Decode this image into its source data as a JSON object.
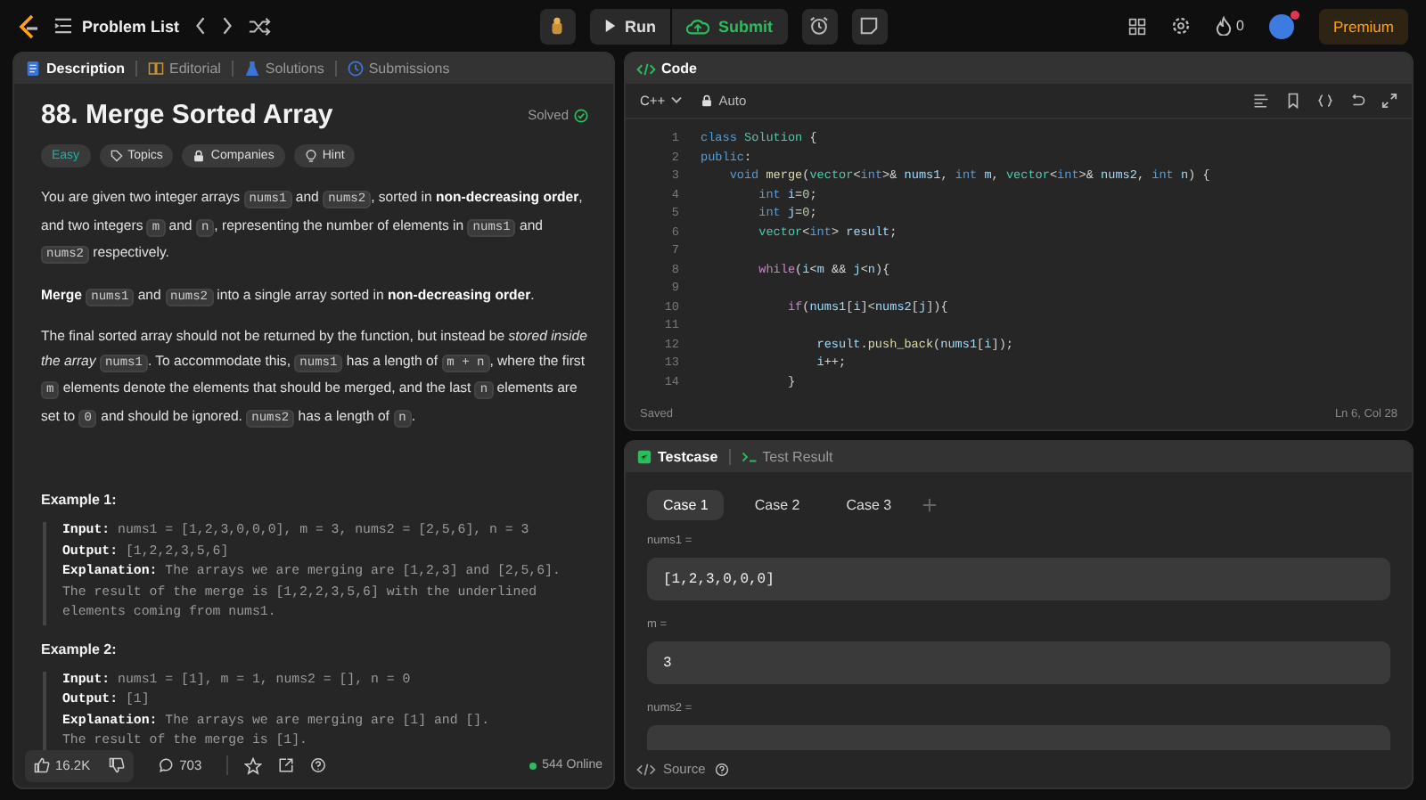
{
  "nav": {
    "title": "Problem List"
  },
  "actions": [
    {
      "label": "Run",
      "kind": "run"
    },
    {
      "label": "Submit",
      "kind": "submit"
    }
  ],
  "streak": {
    "count": "0"
  },
  "premium": {
    "label": "Premium"
  },
  "left_tabs": [
    {
      "label": "Description",
      "selected": true,
      "kind": "description"
    },
    {
      "label": "Editorial",
      "selected": false,
      "kind": "editorial"
    },
    {
      "label": "Solutions",
      "selected": false,
      "kind": "solutions"
    },
    {
      "label": "Submissions",
      "selected": false,
      "kind": "submissions"
    }
  ],
  "problem": {
    "title": "88. Merge Sorted Array",
    "status": "Solved",
    "tags": [
      {
        "label": "Easy",
        "kind": "difficulty"
      },
      {
        "label": "Topics",
        "kind": "topics"
      },
      {
        "label": "Companies",
        "kind": "companies"
      },
      {
        "label": "Hint",
        "kind": "hint"
      }
    ],
    "paragraphs": [
      [
        {
          "t": "You are given two integer arrays ",
          "kind": "text"
        },
        {
          "t": "nums1",
          "kind": "code"
        },
        {
          "t": " and ",
          "kind": "text"
        },
        {
          "t": "nums2",
          "kind": "code"
        },
        {
          "t": ", sorted in **non-decreasing order**, and two integers ",
          "kind": "text"
        },
        {
          "t": "m",
          "kind": "code"
        },
        {
          "t": " and ",
          "kind": "text"
        },
        {
          "t": "n",
          "kind": "code"
        },
        {
          "t": ", representing the number of elements in ",
          "kind": "text"
        },
        {
          "t": "nums1",
          "kind": "code"
        },
        {
          "t": " and ",
          "kind": "text"
        },
        {
          "t": "nums2",
          "kind": "code"
        },
        {
          "t": " respectively.",
          "kind": "text"
        }
      ],
      [
        {
          "t": "**Merge** ",
          "kind": "text"
        },
        {
          "t": "nums1",
          "kind": "code"
        },
        {
          "t": " and ",
          "kind": "text"
        },
        {
          "t": "nums2",
          "kind": "code"
        },
        {
          "t": " into a single array sorted in **non-decreasing order**.",
          "kind": "text"
        }
      ],
      [
        {
          "t": "The final sorted array should not be returned by the function, but instead be *stored inside the array* ",
          "kind": "text"
        },
        {
          "t": "nums1",
          "kind": "code"
        },
        {
          "t": ". To accommodate this, ",
          "kind": "text"
        },
        {
          "t": "nums1",
          "kind": "code"
        },
        {
          "t": " has a length of ",
          "kind": "text"
        },
        {
          "t": "m + n",
          "kind": "code"
        },
        {
          "t": ", where the first ",
          "kind": "text"
        },
        {
          "t": "m",
          "kind": "code"
        },
        {
          "t": " elements denote the elements that should be merged, and the last ",
          "kind": "text"
        },
        {
          "t": "n",
          "kind": "code"
        },
        {
          "t": " elements are set to ",
          "kind": "text"
        },
        {
          "t": "0",
          "kind": "code"
        },
        {
          "t": " and should be ignored. ",
          "kind": "text"
        },
        {
          "t": "nums2",
          "kind": "code"
        },
        {
          "t": " has a length of ",
          "kind": "text"
        },
        {
          "t": "n",
          "kind": "code"
        },
        {
          "t": ".",
          "kind": "text"
        }
      ]
    ],
    "examples": [
      {
        "title": "Example 1:",
        "lines": [
          "**Input:** nums1 = [1,2,3,0,0,0], m = 3, nums2 = [2,5,6], n = 3",
          "**Output:** [1,2,2,3,5,6]",
          "**Explanation:** The arrays we are merging are [1,2,3] and [2,5,6].",
          "The result of the merge is [1,2,2,3,5,6] with the underlined",
          "elements coming from nums1."
        ]
      },
      {
        "title": "Example 2:",
        "lines": [
          "**Input:** nums1 = [1], m = 1, nums2 = [], n = 0",
          "**Output:** [1]",
          "**Explanation:** The arrays we are merging are [1] and [].",
          "The result of the merge is [1]."
        ]
      }
    ]
  },
  "footer": {
    "likes": "16.2K",
    "comments": "703",
    "online": "544 Online"
  },
  "editor": {
    "title": "Code",
    "language": "C++",
    "mode": "Auto",
    "status": "Saved",
    "cursor": "Ln 6, Col 28",
    "lines": [
      {
        "number": "1",
        "tokens": [
          {
            "t": "class ",
            "kind": "kw"
          },
          {
            "t": "Solution",
            "kind": "type"
          },
          {
            "t": " {",
            "kind": "plain"
          }
        ]
      },
      {
        "number": "2",
        "tokens": [
          {
            "t": "public",
            "kind": "kw"
          },
          {
            "t": ":",
            "kind": "plain"
          }
        ]
      },
      {
        "number": "3",
        "tokens": [
          {
            "t": "    void ",
            "kind": "kw"
          },
          {
            "t": "merge",
            "kind": "fn"
          },
          {
            "t": "(",
            "kind": "plain"
          },
          {
            "t": "vector",
            "kind": "type"
          },
          {
            "t": "<",
            "kind": "plain"
          },
          {
            "t": "int",
            "kind": "kw"
          },
          {
            "t": ">& ",
            "kind": "plain"
          },
          {
            "t": "nums1",
            "kind": "var"
          },
          {
            "t": ", ",
            "kind": "plain"
          },
          {
            "t": "int ",
            "kind": "kw"
          },
          {
            "t": "m",
            "kind": "var"
          },
          {
            "t": ", ",
            "kind": "plain"
          },
          {
            "t": "vector",
            "kind": "type"
          },
          {
            "t": "<",
            "kind": "plain"
          },
          {
            "t": "int",
            "kind": "kw"
          },
          {
            "t": ">& ",
            "kind": "plain"
          },
          {
            "t": "nums2",
            "kind": "var"
          },
          {
            "t": ", ",
            "kind": "plain"
          },
          {
            "t": "int ",
            "kind": "kw"
          },
          {
            "t": "n",
            "kind": "var"
          },
          {
            "t": ") {",
            "kind": "plain"
          }
        ]
      },
      {
        "number": "4",
        "tokens": [
          {
            "t": "        int ",
            "kind": "kw"
          },
          {
            "t": "i",
            "kind": "var"
          },
          {
            "t": "=",
            "kind": "plain"
          },
          {
            "t": "0",
            "kind": "num"
          },
          {
            "t": ";",
            "kind": "plain"
          }
        ]
      },
      {
        "number": "5",
        "tokens": [
          {
            "t": "        int ",
            "kind": "kw"
          },
          {
            "t": "j",
            "kind": "var"
          },
          {
            "t": "=",
            "kind": "plain"
          },
          {
            "t": "0",
            "kind": "num"
          },
          {
            "t": ";",
            "kind": "plain"
          }
        ]
      },
      {
        "number": "6",
        "tokens": [
          {
            "t": "        vector",
            "kind": "type"
          },
          {
            "t": "<",
            "kind": "plain"
          },
          {
            "t": "int",
            "kind": "kw"
          },
          {
            "t": "> ",
            "kind": "plain"
          },
          {
            "t": "result",
            "kind": "var"
          },
          {
            "t": ";",
            "kind": "plain"
          }
        ]
      },
      {
        "number": "7"
      },
      {
        "number": "8",
        "tokens": [
          {
            "t": "        while",
            "kind": "ctrl"
          },
          {
            "t": "(",
            "kind": "plain"
          },
          {
            "t": "i",
            "kind": "var"
          },
          {
            "t": "<",
            "kind": "plain"
          },
          {
            "t": "m",
            "kind": "var"
          },
          {
            "t": " && ",
            "kind": "plain"
          },
          {
            "t": "j",
            "kind": "var"
          },
          {
            "t": "<",
            "kind": "plain"
          },
          {
            "t": "n",
            "kind": "var"
          },
          {
            "t": "){",
            "kind": "plain"
          }
        ]
      },
      {
        "number": "9"
      },
      {
        "number": "10",
        "tokens": [
          {
            "t": "            if",
            "kind": "ctrl"
          },
          {
            "t": "(",
            "kind": "plain"
          },
          {
            "t": "nums1",
            "kind": "var"
          },
          {
            "t": "[",
            "kind": "plain"
          },
          {
            "t": "i",
            "kind": "var"
          },
          {
            "t": "]<",
            "kind": "plain"
          },
          {
            "t": "nums2",
            "kind": "var"
          },
          {
            "t": "[",
            "kind": "plain"
          },
          {
            "t": "j",
            "kind": "var"
          },
          {
            "t": "]){",
            "kind": "plain"
          }
        ]
      },
      {
        "number": "11"
      },
      {
        "number": "12",
        "tokens": [
          {
            "t": "                result",
            "kind": "var"
          },
          {
            "t": ".",
            "kind": "plain"
          },
          {
            "t": "push_back",
            "kind": "fn"
          },
          {
            "t": "(",
            "kind": "plain"
          },
          {
            "t": "nums1",
            "kind": "var"
          },
          {
            "t": "[",
            "kind": "plain"
          },
          {
            "t": "i",
            "kind": "var"
          },
          {
            "t": "]);",
            "kind": "plain"
          }
        ]
      },
      {
        "number": "13",
        "tokens": [
          {
            "t": "                i",
            "kind": "var"
          },
          {
            "t": "++;",
            "kind": "plain"
          }
        ]
      },
      {
        "number": "14",
        "tokens": [
          {
            "t": "            }",
            "kind": "plain"
          }
        ]
      }
    ]
  },
  "testcase": {
    "tabs": [
      {
        "label": "Testcase",
        "selected": true,
        "kind": "testcase"
      },
      {
        "label": "Test Result",
        "selected": false,
        "kind": "result"
      }
    ],
    "cases": [
      {
        "label": "Case 1",
        "selected": true
      },
      {
        "label": "Case 2",
        "selected": false
      },
      {
        "label": "Case 3",
        "selected": false
      }
    ],
    "params": [
      {
        "name": "nums1 =",
        "value": "[1,2,3,0,0,0]"
      },
      {
        "name": "m =",
        "value": "3"
      },
      {
        "name": "nums2 ="
      }
    ],
    "source": "Source"
  }
}
